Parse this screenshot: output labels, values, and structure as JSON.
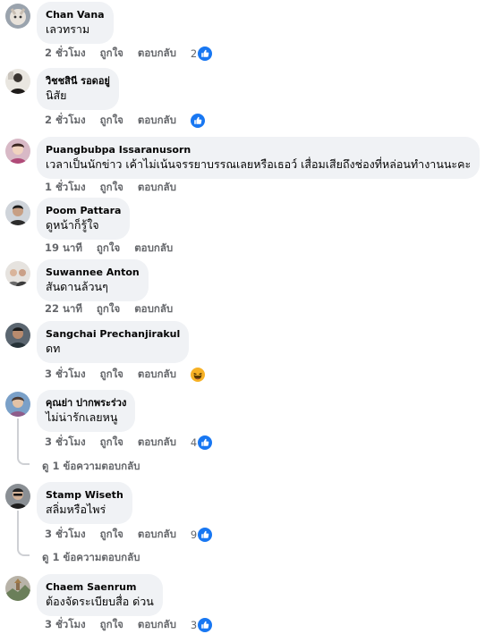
{
  "comments": [
    {
      "author": "Chan Vana",
      "text": "เลวทราม",
      "time": "2 ชั่วโมง",
      "like": "ถูกใจ",
      "reply": "ตอบกลับ",
      "reactions": "2",
      "reaction_icon": "like-icon"
    },
    {
      "author": "วิชชสินี รอดอยู่",
      "text": "นิสัย",
      "time": "2 ชั่วโมง",
      "like": "ถูกใจ",
      "reply": "ตอบกลับ",
      "reactions": "",
      "reaction_icon": "like-icon"
    },
    {
      "author": "Puangbubpa Issaranusorn",
      "text": "เวลาเป็นนักข่าว เค้าไม่เน้นจรรยาบรรณเลยหรือเธอว์ เสื่อมเสียถึงช่องที่หล่อนทำงานนะคะ",
      "time": "1 ชั่วโมง",
      "like": "ถูกใจ",
      "reply": "ตอบกลับ",
      "reactions": "",
      "reaction_icon": ""
    },
    {
      "author": "Poom Pattara",
      "text": "ดูหน้าก็รู้ใจ",
      "time": "19 นาที",
      "like": "ถูกใจ",
      "reply": "ตอบกลับ",
      "reactions": "",
      "reaction_icon": ""
    },
    {
      "author": "Suwannee Anton",
      "text": "สันดานล้วนๆ",
      "time": "22 นาที",
      "like": "ถูกใจ",
      "reply": "ตอบกลับ",
      "reactions": "",
      "reaction_icon": ""
    },
    {
      "author": "Sangchai Prechanjirakul",
      "text": "ดท",
      "time": "3 ชั่วโมง",
      "like": "ถูกใจ",
      "reply": "ตอบกลับ",
      "reactions": "",
      "reaction_icon": "haha-icon"
    },
    {
      "author": "คุณย่า ปากพระร่วง",
      "text": "ไม่น่ารักเลยหนู",
      "time": "3 ชั่วโมง",
      "like": "ถูกใจ",
      "reply": "ตอบกลับ",
      "reactions": "4",
      "reaction_icon": "like-icon",
      "view_replies": "ดู 1 ข้อความตอบกลับ"
    },
    {
      "author": "Stamp Wiseth",
      "text": "สลิ่มหรือไพร่",
      "time": "3 ชั่วโมง",
      "like": "ถูกใจ",
      "reply": "ตอบกลับ",
      "reactions": "9",
      "reaction_icon": "like-icon",
      "view_replies": "ดู 1 ข้อความตอบกลับ"
    },
    {
      "author": "Chaem Saenrum",
      "text": "ต้องจัดระเบียบสื่อ ด่วน",
      "time": "3 ชั่วโมง",
      "like": "ถูกใจ",
      "reply": "ตอบกลับ",
      "reactions": "3",
      "reaction_icon": "like-icon"
    }
  ],
  "colors": {
    "like_blue": "#1877f2",
    "haha_yellow": "#f7b125",
    "bubble_bg": "#f0f2f5",
    "meta_gray": "#65676b"
  }
}
